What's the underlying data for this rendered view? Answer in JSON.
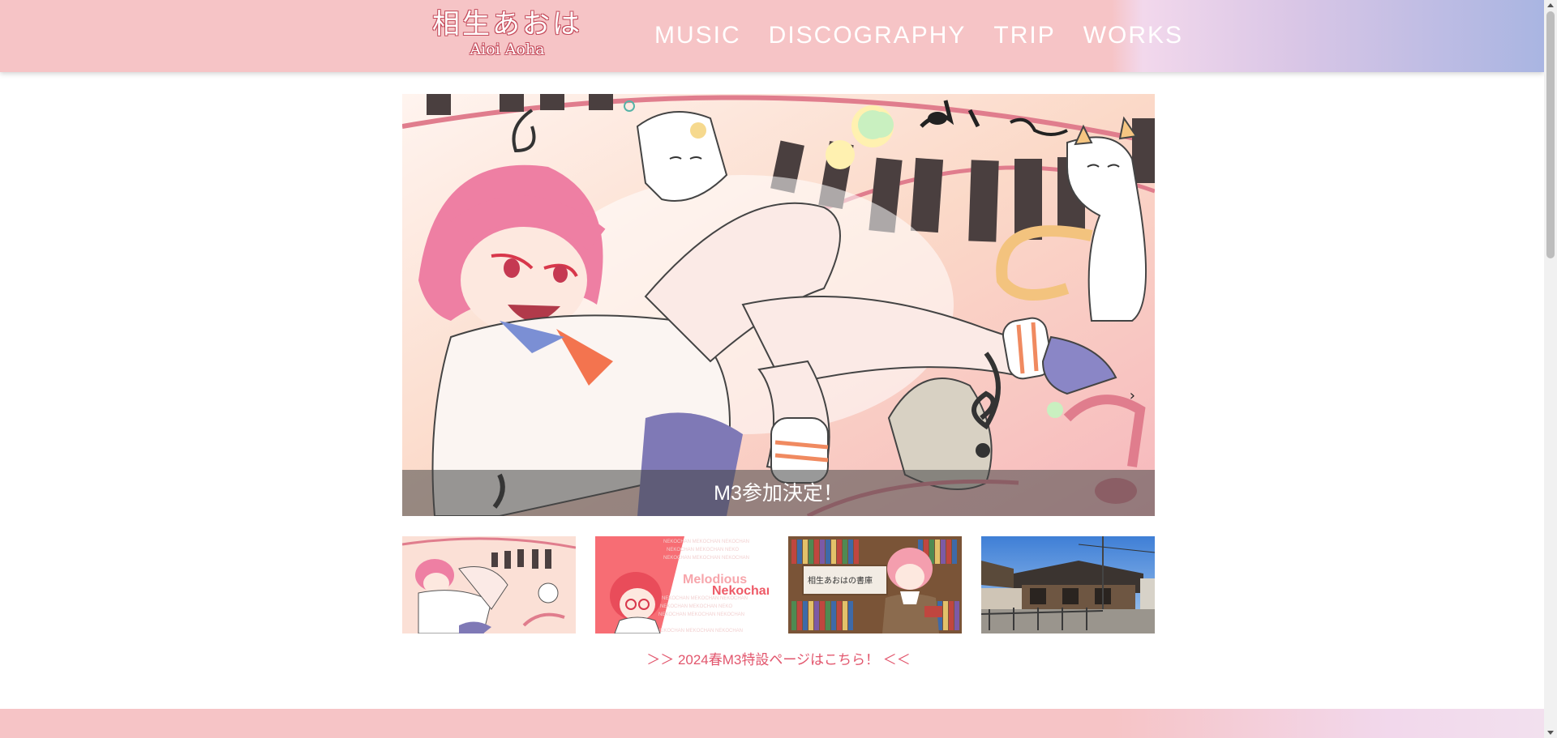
{
  "site": {
    "logo_jp": "相生あおは",
    "logo_en": "Aioi Aoha"
  },
  "nav": {
    "items": [
      {
        "label": "MUSIC"
      },
      {
        "label": "DISCOGRAPHY"
      },
      {
        "label": "TRIP"
      },
      {
        "label": "WORKS"
      }
    ]
  },
  "hero": {
    "caption": "M3参加決定！"
  },
  "thumbnails": [
    {
      "name": "m3-illustration"
    },
    {
      "name": "melodious-nekochan",
      "text_line1": "Melodious",
      "text_line2": "Nekochan"
    },
    {
      "name": "bookshelf",
      "sign_text": "相生あおはの書庫"
    },
    {
      "name": "trip-photo"
    }
  ],
  "special_link": {
    "label": "＞＞ 2024春M3特設ページはこちら！ ＜＜"
  },
  "colors": {
    "header_pink": "#f6c4c6",
    "header_blue": "#a9b5e2",
    "link_red": "#e2566d",
    "logo_outline": "#c44c5c"
  }
}
